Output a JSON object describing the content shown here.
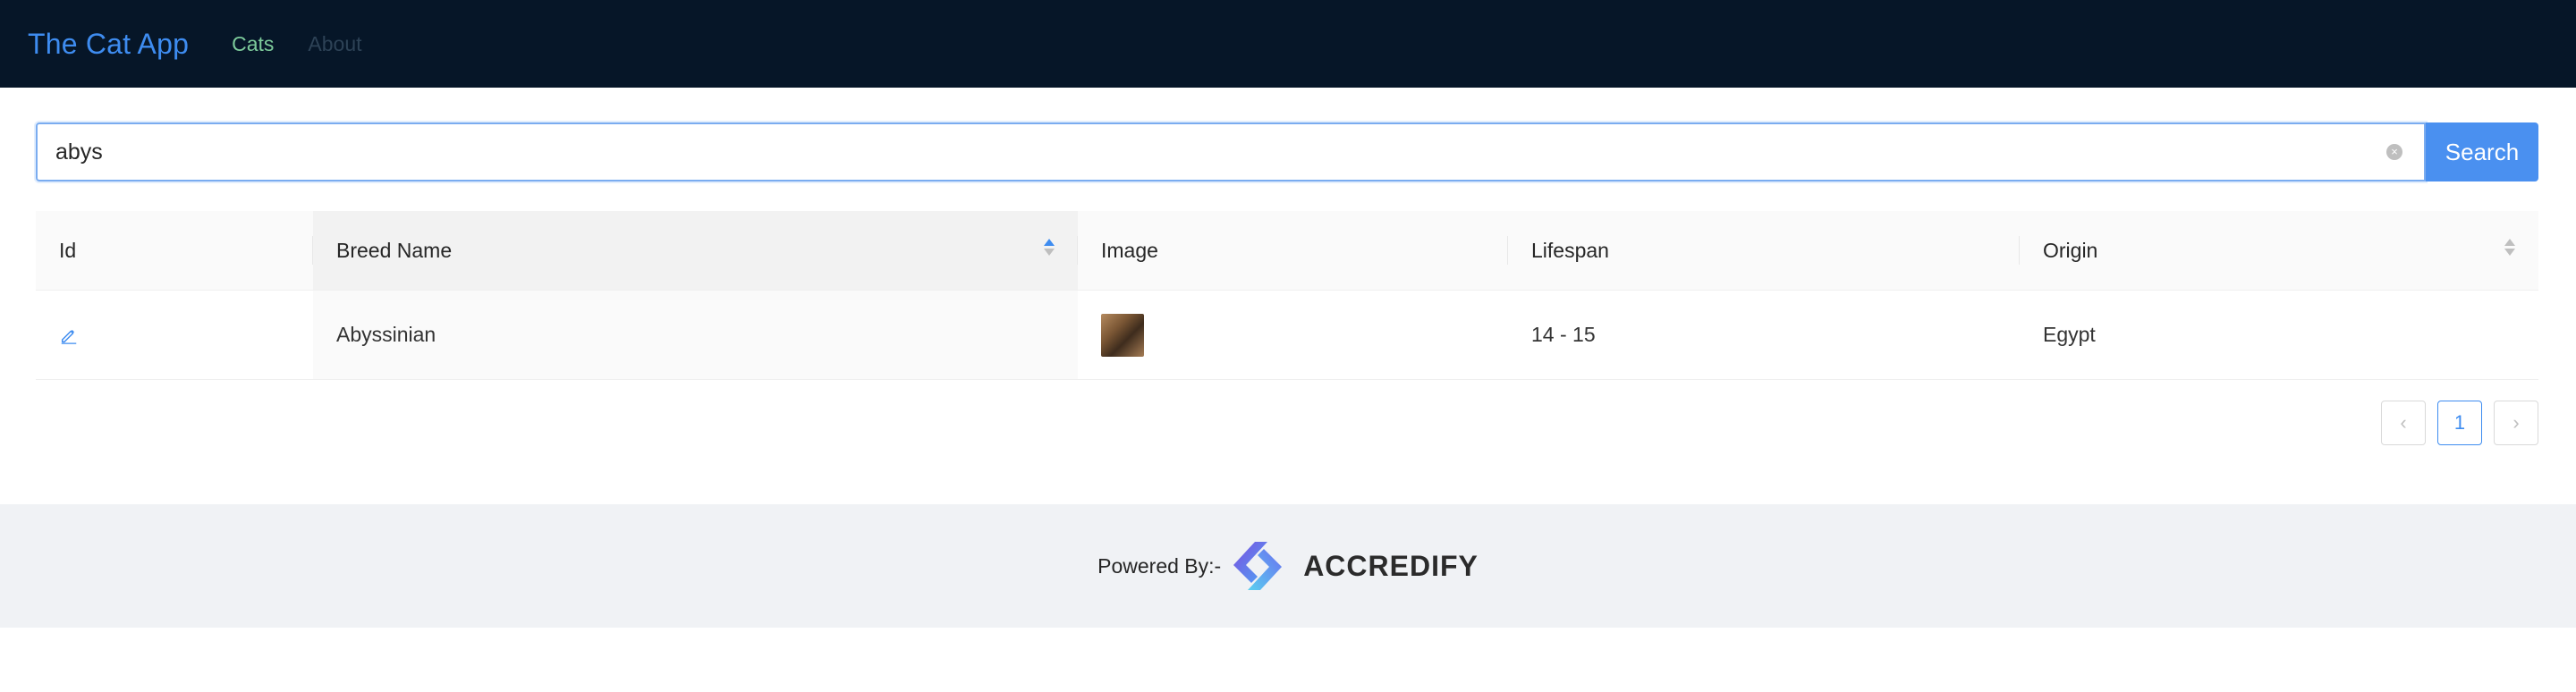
{
  "navbar": {
    "brand": "The Cat App",
    "links": [
      "Cats",
      "About"
    ]
  },
  "search": {
    "value": "abys",
    "button_label": "Search"
  },
  "table": {
    "columns": [
      "Id",
      "Breed Name",
      "Image",
      "Lifespan",
      "Origin"
    ],
    "rows": [
      {
        "breed": "Abyssinian",
        "lifespan": "14 - 15",
        "origin": "Egypt"
      }
    ]
  },
  "pagination": {
    "prev_icon": "‹",
    "current_page": "1",
    "next_icon": "›"
  },
  "footer": {
    "powered_by": "Powered By:-",
    "logo_text": "ACCREDIFY"
  },
  "colors": {
    "navbar_bg": "#061628",
    "brand": "#3e8cf0",
    "active_link": "#7dcb9b",
    "primary": "#4a90f0",
    "footer_bg": "#f0f2f5"
  }
}
